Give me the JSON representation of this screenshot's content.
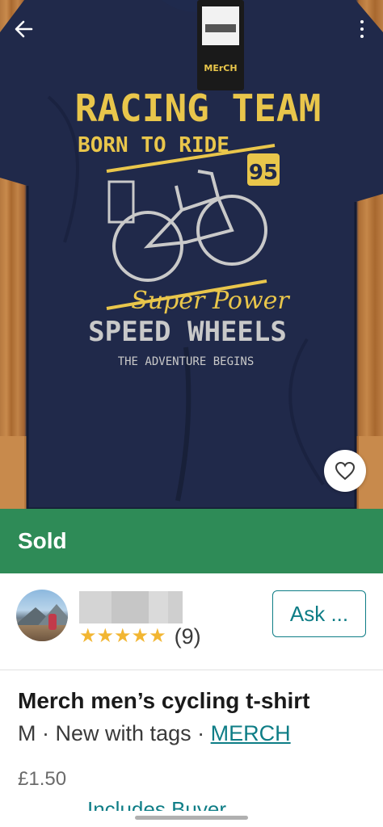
{
  "photo": {
    "shirt_print": {
      "line1": "RACING TEAM",
      "line2": "BORN TO RIDE",
      "number": "95",
      "script": "Super Power",
      "line3": "SPEED WHEELS",
      "line4": "THE ADVENTURE BEGINS"
    },
    "tag_brand": "MErCH",
    "back_icon": "arrow-left-icon",
    "more_icon": "more-vertical-icon",
    "favourite_icon": "heart-outline-icon"
  },
  "status": {
    "label": "Sold",
    "color": "#2e8b57"
  },
  "seller": {
    "rating_stars": "★★★★★",
    "rating_value": 5,
    "review_count": "(9)",
    "ask_button": "Ask ..."
  },
  "item": {
    "title": "Merch men’s cycling t-shirt",
    "size": "M",
    "condition": "New with tags",
    "separator": "·",
    "brand": "MERCH",
    "price": "£1.50",
    "buyer_protection_link": "Includes Buyer"
  },
  "colors": {
    "accent": "#0e7d86",
    "star": "#f2b632"
  }
}
